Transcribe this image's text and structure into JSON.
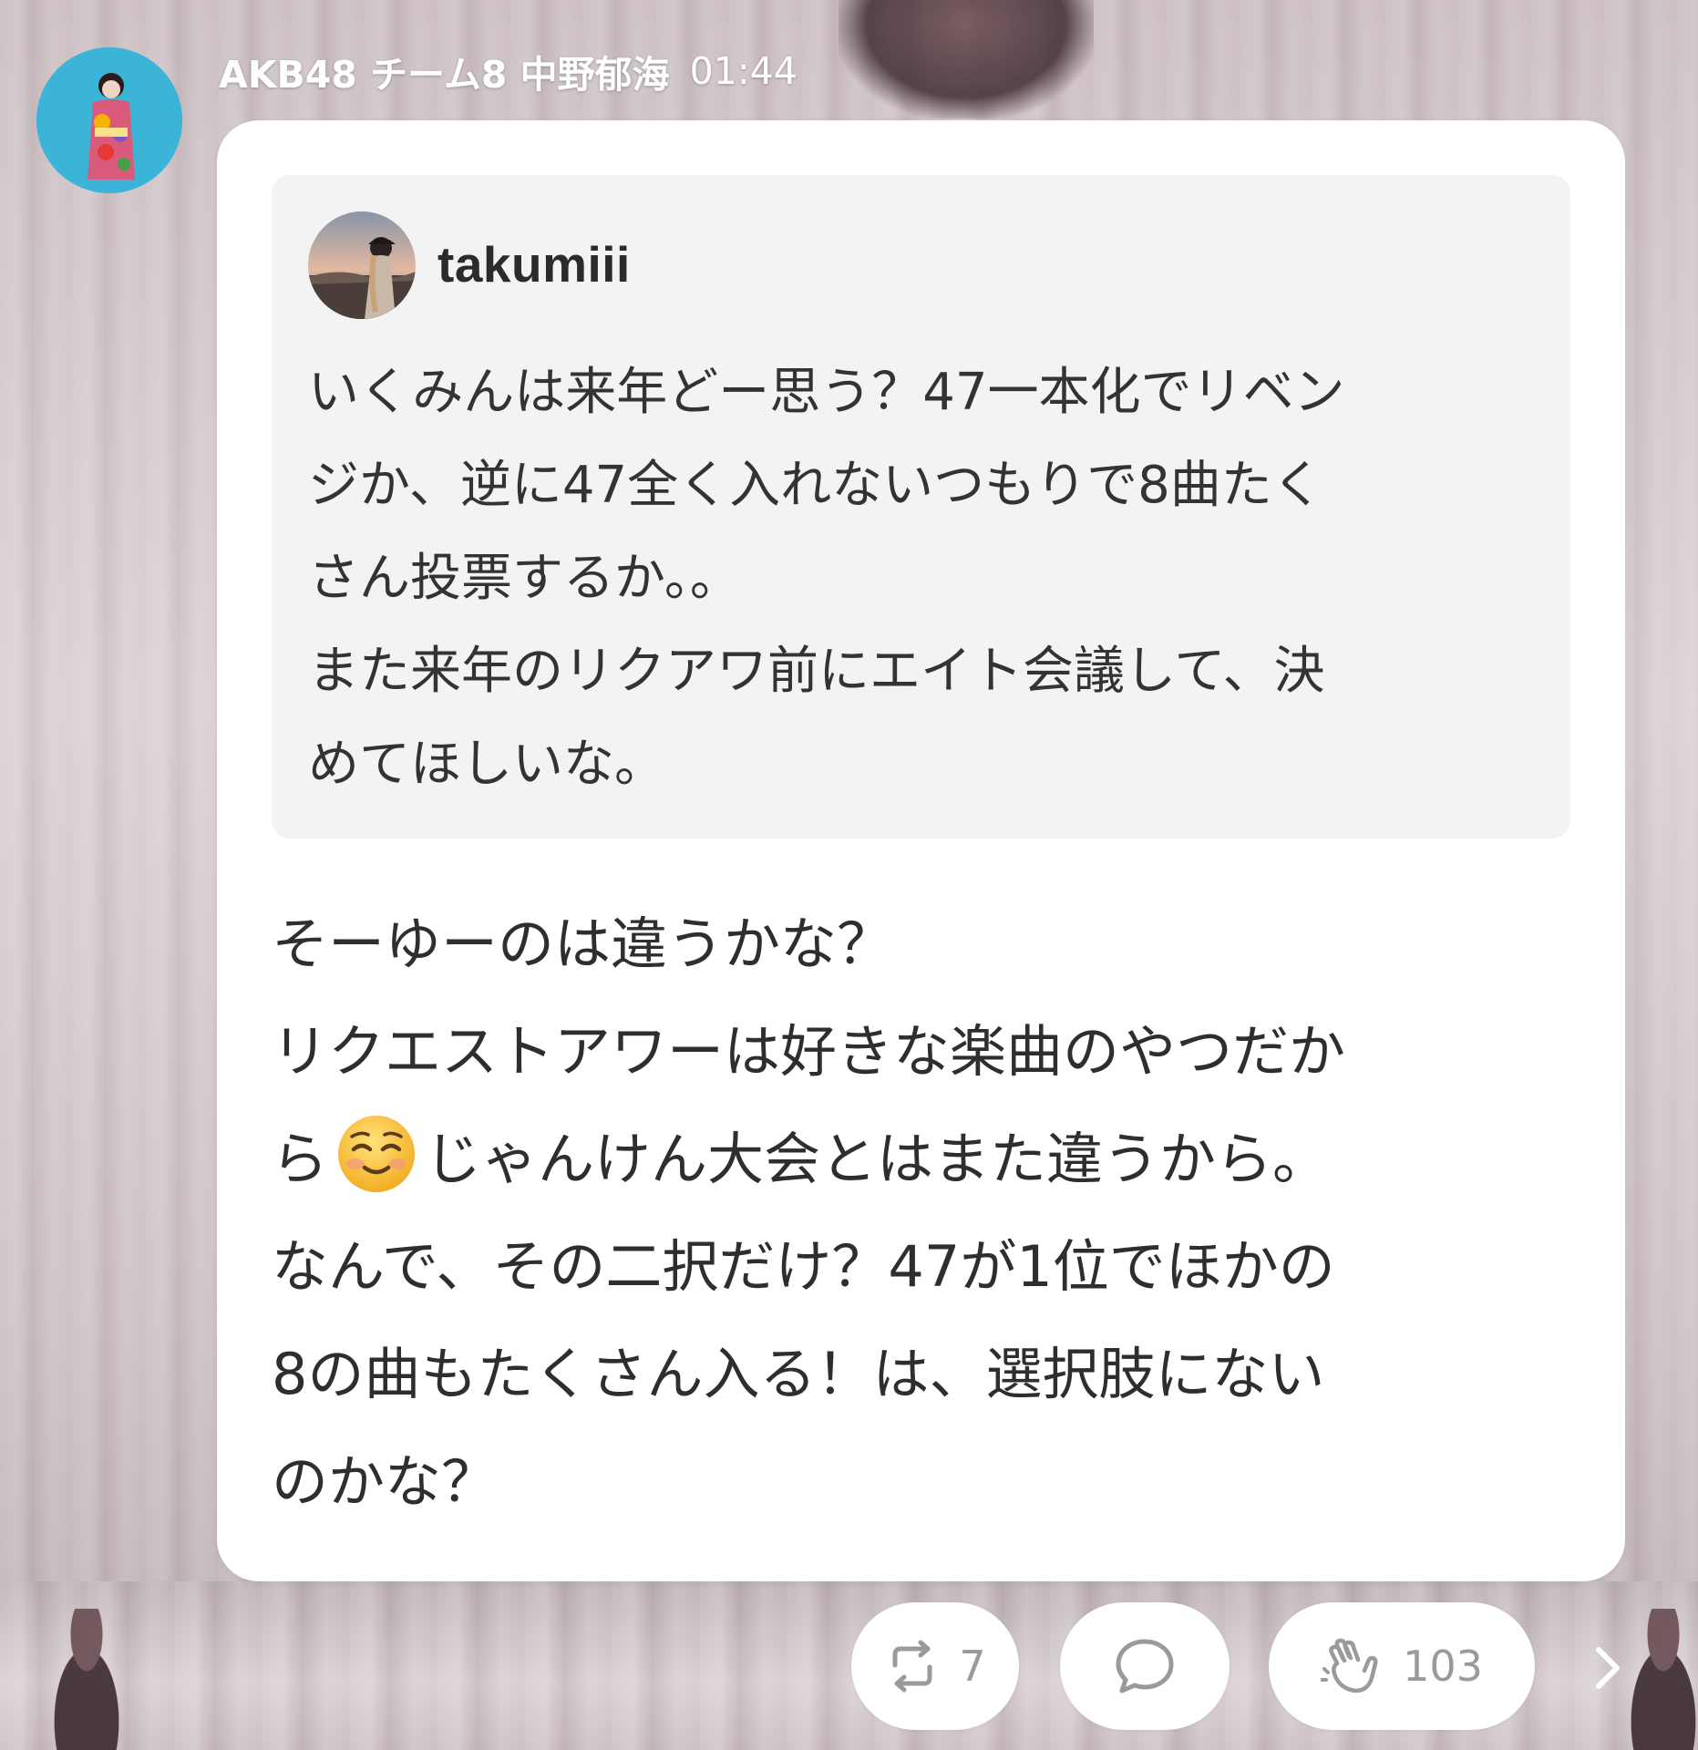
{
  "header": {
    "author": "AKB48 チーム8 中野郁海",
    "time": "01:44"
  },
  "quote": {
    "username": "takumiii",
    "text": "いくみんは来年どー思う？47一本化でリベン\nジか、逆に47全く入れないつもりで8曲たく\nさん投票するか。。\nまた来年のリクアワ前にエイト会議して、決\nめてほしいな。"
  },
  "reply": {
    "line1": "そーゆーのは違うかな？",
    "line2": "リクエストアワーは好きな楽曲のやつだか",
    "line3_before_emoji": "ら",
    "emoji": "smiling-face-icon",
    "line3_after_emoji": "じゃんけん大会とはまた違うから。",
    "line4": "なんで、その二択だけ？47が1位でほかの",
    "line5": "8の曲もたくさん入る！は、選択肢にない",
    "line6": "のかな？"
  },
  "actions": {
    "repost_count": "7",
    "comment_icon": "speech-bubble-icon",
    "clap_count": "103",
    "next_icon": "chevron-right-icon"
  },
  "colors": {
    "card_bg": "#ffffff",
    "quote_bg": "#f3f3f3",
    "text": "#2e2e2e",
    "icon_gray": "#9a9a9a",
    "avatar_bg": "#3bb4d8"
  }
}
